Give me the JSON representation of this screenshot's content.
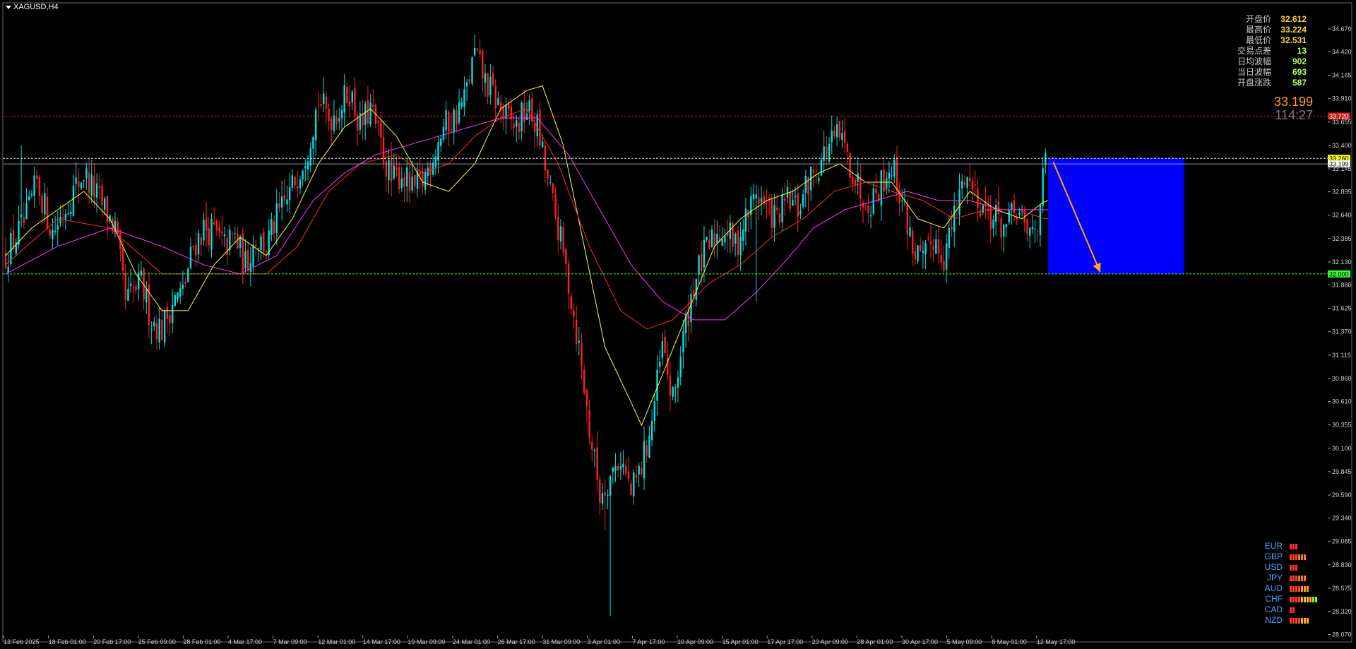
{
  "symbol_title": "XAGUSD,H4",
  "stats_panel": [
    {
      "label": "开盘价",
      "value": "32.612",
      "color": "yellow"
    },
    {
      "label": "最高价",
      "value": "33.224",
      "color": "yellow"
    },
    {
      "label": "最低价",
      "value": "32.531",
      "color": "yellow"
    },
    {
      "label": "交易点差",
      "value": "13",
      "color": "green"
    },
    {
      "label": "日均波幅",
      "value": "902",
      "color": "green"
    },
    {
      "label": "当日波幅",
      "value": "693",
      "color": "green"
    },
    {
      "label": "开盘涨跌",
      "value": "587",
      "color": "green"
    }
  ],
  "big_price": "33.199",
  "countdown": "114:27",
  "currency_strength": [
    {
      "currency": "EUR",
      "level": 3,
      "colors": [
        "#ff3030"
      ]
    },
    {
      "currency": "GBP",
      "level": 6,
      "colors": [
        "#ff4020",
        "#ff7a1a"
      ]
    },
    {
      "currency": "USD",
      "level": 3,
      "colors": [
        "#ff3030"
      ]
    },
    {
      "currency": "JPY",
      "level": 6,
      "colors": [
        "#ff4020",
        "#ff7a1a"
      ]
    },
    {
      "currency": "AUD",
      "level": 7,
      "colors": [
        "#ff4020",
        "#ff9a1a"
      ]
    },
    {
      "currency": "CHF",
      "level": 10,
      "colors": [
        "#ff4020",
        "#ffb020",
        "#7aff20"
      ]
    },
    {
      "currency": "CAD",
      "level": 2,
      "colors": [
        "#ff3030"
      ]
    },
    {
      "currency": "NZD",
      "level": 7,
      "colors": [
        "#ff4020",
        "#ffb020"
      ]
    }
  ],
  "chart_data": {
    "type": "candlestick",
    "title": "XAGUSD,H4",
    "ylim": [
      28.02,
      34.77
    ],
    "y_ticks": [
      "34.670",
      "34.420",
      "34.165",
      "33.910",
      "33.655",
      "33.400",
      "33.145",
      "32.895",
      "32.640",
      "32.385",
      "32.130",
      "31.880",
      "31.625",
      "31.370",
      "31.115",
      "30.860",
      "30.610",
      "30.355",
      "30.100",
      "29.845",
      "29.590",
      "29.340",
      "29.085",
      "28.830",
      "28.575",
      "28.320",
      "28.070"
    ],
    "x_ticks": [
      "13 Feb 2025",
      "18 Feb 01:00",
      "20 Feb 17:00",
      "25 Feb 09:00",
      "28 Feb 01:00",
      "4 Mar 17:00",
      "7 Mar 09:00",
      "12 Mar 01:00",
      "14 Mar 17:00",
      "19 Mar 09:00",
      "24 Mar 01:00",
      "26 Mar 17:00",
      "31 Mar 09:00",
      "3 Apr 01:00",
      "7 Apr 17:00",
      "10 Apr 09:00",
      "15 Apr 01:00",
      "17 Apr 17:00",
      "23 Apr 09:00",
      "28 Apr 01:00",
      "30 Apr 17:00",
      "5 May 09:00",
      "8 May 01:00",
      "12 May 17:00"
    ],
    "grid": false,
    "bull_color": "#00e0e0",
    "bear_color": "#ff2020",
    "close_keypoints": [
      [
        0,
        32.2
      ],
      [
        8,
        32.6
      ],
      [
        12,
        33.0
      ],
      [
        18,
        32.45
      ],
      [
        26,
        32.9
      ],
      [
        30,
        33.1
      ],
      [
        36,
        32.8
      ],
      [
        42,
        32.5
      ],
      [
        46,
        31.7
      ],
      [
        52,
        31.9
      ],
      [
        56,
        31.5
      ],
      [
        60,
        31.4
      ],
      [
        64,
        31.7
      ],
      [
        68,
        31.8
      ],
      [
        72,
        32.3
      ],
      [
        76,
        32.5
      ],
      [
        80,
        32.45
      ],
      [
        84,
        32.3
      ],
      [
        88,
        32.4
      ],
      [
        92,
        32.1
      ],
      [
        96,
        32.4
      ],
      [
        100,
        32.3
      ],
      [
        104,
        32.6
      ],
      [
        108,
        32.8
      ],
      [
        112,
        33.1
      ],
      [
        116,
        33.4
      ],
      [
        120,
        33.9
      ],
      [
        124,
        33.7
      ],
      [
        128,
        33.8
      ],
      [
        132,
        34.0
      ],
      [
        136,
        33.6
      ],
      [
        140,
        33.8
      ],
      [
        144,
        33.4
      ],
      [
        148,
        33.0
      ],
      [
        152,
        33.1
      ],
      [
        156,
        32.9
      ],
      [
        160,
        33.0
      ],
      [
        164,
        33.3
      ],
      [
        168,
        33.6
      ],
      [
        172,
        33.7
      ],
      [
        176,
        33.9
      ],
      [
        180,
        34.4
      ],
      [
        184,
        34.1
      ],
      [
        188,
        33.9
      ],
      [
        192,
        33.7
      ],
      [
        196,
        33.6
      ],
      [
        200,
        33.8
      ],
      [
        204,
        33.6
      ],
      [
        208,
        33.0
      ],
      [
        212,
        32.5
      ],
      [
        216,
        31.9
      ],
      [
        220,
        31.2
      ],
      [
        224,
        30.3
      ],
      [
        228,
        29.6
      ],
      [
        232,
        29.8
      ],
      [
        236,
        30.0
      ],
      [
        240,
        29.6
      ],
      [
        244,
        29.9
      ],
      [
        248,
        30.4
      ],
      [
        252,
        31.2
      ],
      [
        256,
        30.6
      ],
      [
        260,
        31.3
      ],
      [
        264,
        31.9
      ],
      [
        268,
        32.2
      ],
      [
        272,
        32.4
      ],
      [
        276,
        32.5
      ],
      [
        280,
        32.3
      ],
      [
        284,
        32.6
      ],
      [
        288,
        32.9
      ],
      [
        292,
        32.7
      ],
      [
        296,
        32.6
      ],
      [
        300,
        32.8
      ],
      [
        304,
        32.7
      ],
      [
        308,
        33.0
      ],
      [
        312,
        33.2
      ],
      [
        316,
        33.4
      ],
      [
        320,
        33.5
      ],
      [
        324,
        33.2
      ],
      [
        328,
        32.9
      ],
      [
        332,
        32.8
      ],
      [
        336,
        33.0
      ],
      [
        340,
        33.2
      ],
      [
        344,
        32.8
      ],
      [
        348,
        32.3
      ],
      [
        352,
        32.1
      ],
      [
        356,
        32.4
      ],
      [
        360,
        32.2
      ],
      [
        364,
        32.6
      ],
      [
        368,
        33.1
      ],
      [
        372,
        32.9
      ],
      [
        376,
        32.7
      ],
      [
        380,
        32.6
      ],
      [
        384,
        32.5
      ],
      [
        388,
        32.7
      ],
      [
        392,
        32.4
      ],
      [
        396,
        32.6
      ],
      [
        399,
        33.2
      ]
    ],
    "indicator_lines": [
      {
        "color": "#ffff33",
        "keypoints": [
          [
            0,
            32.2
          ],
          [
            10,
            32.5
          ],
          [
            20,
            32.7
          ],
          [
            30,
            32.9
          ],
          [
            40,
            32.6
          ],
          [
            50,
            32.0
          ],
          [
            60,
            31.6
          ],
          [
            70,
            31.6
          ],
          [
            80,
            32.1
          ],
          [
            90,
            32.4
          ],
          [
            100,
            32.2
          ],
          [
            110,
            32.6
          ],
          [
            120,
            33.2
          ],
          [
            130,
            33.6
          ],
          [
            140,
            33.8
          ],
          [
            150,
            33.5
          ],
          [
            160,
            33.0
          ],
          [
            170,
            32.9
          ],
          [
            180,
            33.2
          ],
          [
            190,
            33.8
          ],
          [
            200,
            34.0
          ],
          [
            206,
            34.05
          ],
          [
            214,
            33.4
          ],
          [
            222,
            32.3
          ],
          [
            230,
            31.2
          ],
          [
            240,
            30.6
          ],
          [
            244,
            30.35
          ],
          [
            252,
            30.9
          ],
          [
            262,
            31.6
          ],
          [
            272,
            32.3
          ],
          [
            282,
            32.6
          ],
          [
            292,
            32.8
          ],
          [
            302,
            32.9
          ],
          [
            312,
            33.1
          ],
          [
            320,
            33.2
          ],
          [
            330,
            33.0
          ],
          [
            340,
            33.0
          ],
          [
            350,
            32.6
          ],
          [
            360,
            32.5
          ],
          [
            370,
            32.9
          ],
          [
            380,
            32.7
          ],
          [
            390,
            32.6
          ],
          [
            399,
            32.8
          ]
        ]
      },
      {
        "color": "#ff2a2a",
        "keypoints": [
          [
            0,
            32.1
          ],
          [
            20,
            32.6
          ],
          [
            40,
            32.5
          ],
          [
            60,
            32.0
          ],
          [
            80,
            32.0
          ],
          [
            100,
            32.0
          ],
          [
            112,
            32.3
          ],
          [
            124,
            32.9
          ],
          [
            136,
            33.2
          ],
          [
            150,
            33.3
          ],
          [
            160,
            33.1
          ],
          [
            170,
            33.2
          ],
          [
            180,
            33.5
          ],
          [
            190,
            33.7
          ],
          [
            200,
            33.8
          ],
          [
            212,
            33.2
          ],
          [
            224,
            32.3
          ],
          [
            236,
            31.6
          ],
          [
            246,
            31.4
          ],
          [
            256,
            31.5
          ],
          [
            270,
            31.9
          ],
          [
            282,
            32.1
          ],
          [
            294,
            32.4
          ],
          [
            306,
            32.6
          ],
          [
            318,
            32.9
          ],
          [
            330,
            33.0
          ],
          [
            340,
            32.9
          ],
          [
            352,
            32.8
          ],
          [
            364,
            32.6
          ],
          [
            376,
            32.7
          ],
          [
            388,
            32.7
          ],
          [
            399,
            32.6
          ]
        ]
      },
      {
        "color": "#ff33ff",
        "keypoints": [
          [
            0,
            32.0
          ],
          [
            20,
            32.3
          ],
          [
            40,
            32.5
          ],
          [
            60,
            32.3
          ],
          [
            76,
            32.1
          ],
          [
            90,
            32.0
          ],
          [
            104,
            32.2
          ],
          [
            118,
            32.8
          ],
          [
            130,
            33.1
          ],
          [
            142,
            33.3
          ],
          [
            154,
            33.4
          ],
          [
            166,
            33.5
          ],
          [
            178,
            33.6
          ],
          [
            190,
            33.7
          ],
          [
            204,
            33.7
          ],
          [
            216,
            33.3
          ],
          [
            228,
            32.7
          ],
          [
            240,
            32.1
          ],
          [
            252,
            31.7
          ],
          [
            264,
            31.5
          ],
          [
            276,
            31.5
          ],
          [
            288,
            31.8
          ],
          [
            298,
            32.1
          ],
          [
            310,
            32.5
          ],
          [
            322,
            32.7
          ],
          [
            334,
            32.8
          ],
          [
            346,
            32.9
          ],
          [
            358,
            32.8
          ],
          [
            370,
            32.8
          ],
          [
            382,
            32.7
          ],
          [
            392,
            32.7
          ],
          [
            399,
            32.7
          ]
        ]
      }
    ],
    "horizontal_levels": [
      {
        "value": "33.720",
        "color": "#cc2020",
        "style": "dotted",
        "label_bg": "#cc2020",
        "label_color": "#ffffff"
      },
      {
        "value": "33.260",
        "color": "#e0e0e0",
        "style": "dotted",
        "label_bg": "#ffff00",
        "label_color": "#000000"
      },
      {
        "value": "33.199",
        "color": "#8a9ab0",
        "style": "solid",
        "label_bg": "#ffffff",
        "label_color": "#000000"
      },
      {
        "value": "32.000",
        "color": "#30ff30",
        "style": "dotted",
        "label_bg": "#30ff30",
        "label_color": "#000000"
      }
    ],
    "target_box": {
      "start_index": 400,
      "end_index": 450,
      "top": 33.26,
      "bottom": 32.0,
      "color": "#0000ff"
    },
    "arrow": {
      "from_index": 402,
      "from_value": 33.22,
      "to_index": 420,
      "to_value": 32.02,
      "color": "#ffaa00"
    }
  }
}
